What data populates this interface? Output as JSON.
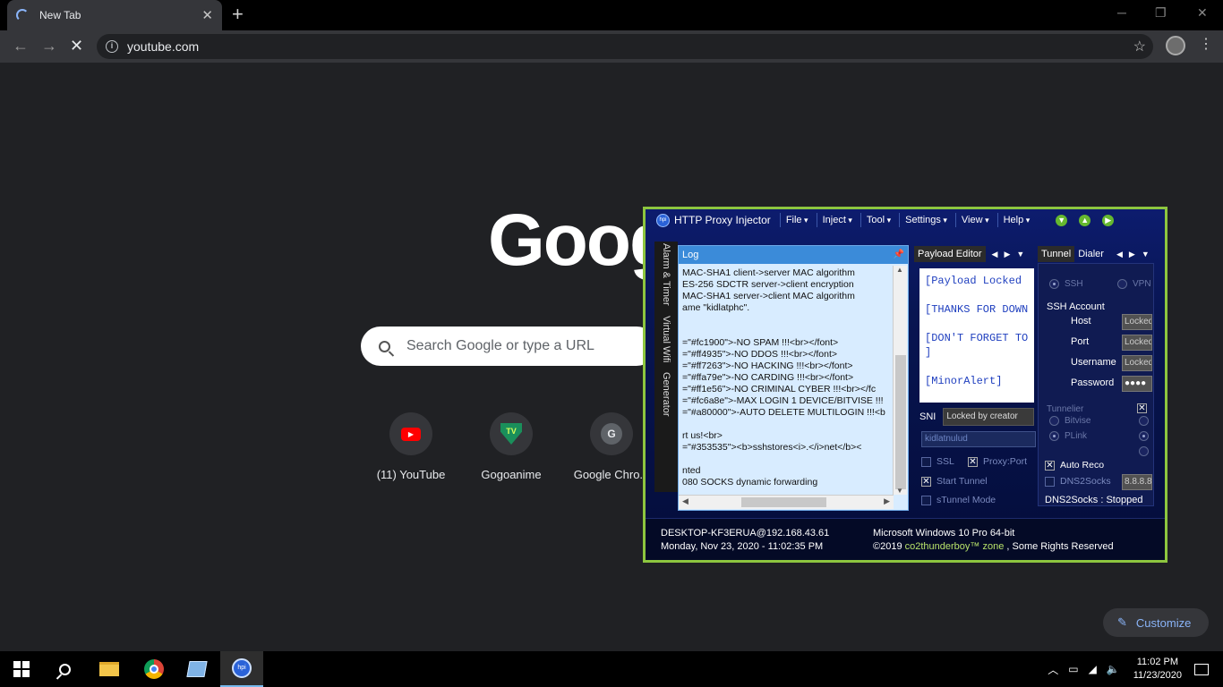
{
  "browser": {
    "tab_title": "New Tab",
    "url": "youtube.com",
    "new_tab_symbol": "+",
    "close_symbol": "✕"
  },
  "newtab": {
    "logo_text": "Goog",
    "search_placeholder": "Search Google or type a URL",
    "shortcuts": [
      {
        "label": "(11) YouTube",
        "icon": "youtube-icon"
      },
      {
        "label": "Gogoanime",
        "icon": "gogoanime-icon"
      },
      {
        "label": "Google Chro...",
        "icon": "letter-g-icon"
      }
    ],
    "customize_label": "Customize"
  },
  "app": {
    "title": "HTTP Proxy Injector",
    "menus": [
      "File",
      "Inject",
      "Tool",
      "Settings",
      "View",
      "Help"
    ],
    "side_tabs": [
      "Alarm & Timer",
      "Virtual Wifi",
      "Generator"
    ],
    "log": {
      "header": "Log",
      "lines": [
        "MAC-SHA1 client->server MAC algorithm",
        "ES-256 SDCTR server->client encryption",
        "MAC-SHA1 server->client MAC algorithm",
        "ame \"kidlatphc\".",
        "",
        "",
        "=\"#fc1900\">-NO SPAM !!!<br></font>",
        "=\"#ff4935\">-NO DDOS !!!<br></font>",
        "=\"#ff7263\">-NO HACKING !!!<br></font>",
        "=\"#ffa79e\">-NO CARDING !!!<br></font>",
        "=\"#ff1e56\">-NO CRIMINAL CYBER !!!<br></fc",
        "=\"#fc6a8e\">-MAX LOGIN 1 DEVICE/BITVISE !!!",
        "=\"#a80000\">-AUTO DELETE MULTILOGIN !!!<b",
        "",
        "rt us!<br>",
        "=\"#353535\"><b>sshstores<i>.</i>net</b><",
        "",
        "nted",
        "080 SOCKS dynamic forwarding"
      ]
    },
    "payload": {
      "tab_label": "Payload Editor",
      "lines": [
        "[Payload Locked",
        "[THANKS FOR DOWN",
        "[DON'T FORGET TO",
        "]",
        "[MinorAlert]"
      ],
      "sni_label": "SNI",
      "sni_value": "Locked by creator",
      "input_value": "kidlatnulud",
      "ssl_label": "SSL",
      "proxy_port_label": "Proxy:Port",
      "start_tunnel_label": "Start Tunnel",
      "stunnel_label": "sTunnel Mode"
    },
    "tunnel": {
      "tab_label": "Tunnel",
      "dialer_label": "Dialer",
      "ssh_label": "SSH",
      "vpn_label": "VPN",
      "account_label": "SSH Account",
      "host_label": "Host",
      "host_value": "Locked",
      "port_label": "Port",
      "port_value": "Locked",
      "username_label": "Username",
      "username_value": "Locked",
      "password_label": "Password",
      "password_value": "●●●●",
      "tunnelier_label": "Tunnelier",
      "bitvise_label": "Bitvise",
      "plink_label": "PLink",
      "auto_reco_label": "Auto Reco",
      "dns2socks_label": "DNS2Socks",
      "dns_value": "8.8.8.8",
      "dns_status": "DNS2Socks : Stopped"
    },
    "status": {
      "host": "DESKTOP-KF3ERUA@192.168.43.61",
      "datetime": "Monday, Nov 23, 2020 - 11:02:35 PM",
      "os": "Microsoft Windows 10 Pro 64-bit",
      "copyright_prefix": "©2019",
      "copyright_author": "co2thunderboy™ zone",
      "copyright_suffix": ", Some Rights Reserved"
    }
  },
  "taskbar": {
    "time": "11:02 PM",
    "date": "11/23/2020"
  }
}
